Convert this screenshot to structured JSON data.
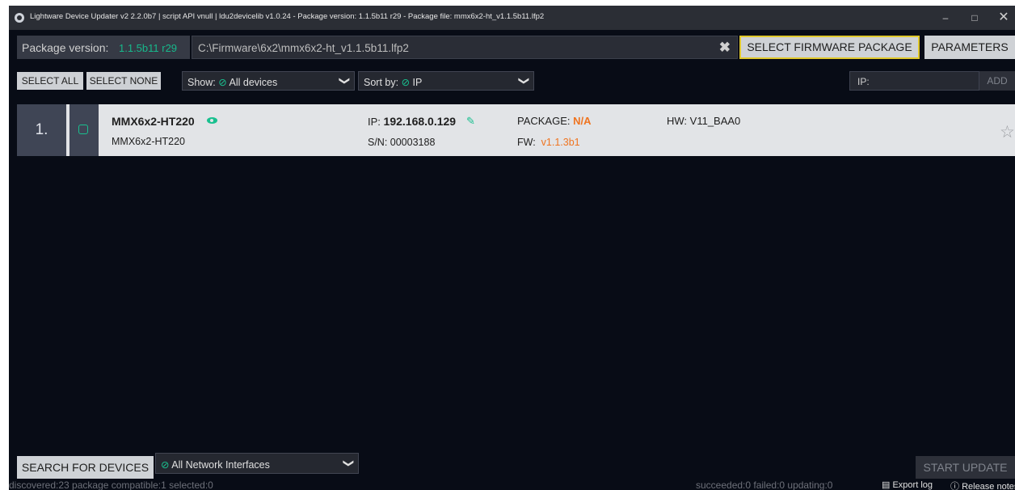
{
  "window": {
    "title": "Lightware Device Updater v2 2.2.0b7 | script API vnull | ldu2devicelib v1.0.24 - Package version: 1.1.5b11 r29 - Package file: mmx6x2-ht_v1.1.5b11.lfp2",
    "controls": {
      "minimize": "–",
      "maximize": "□",
      "close": "✕"
    }
  },
  "package": {
    "version_label": "Package version:",
    "version_value": "1.1.5b11 r29",
    "file_path": "C:\\Firmware\\6x2\\mmx6x2-ht_v1.1.5b11.lfp2",
    "clear_glyph": "✖",
    "select_button": "SELECT FIRMWARE PACKAGE",
    "parameters_button": "PARAMETERS"
  },
  "filters": {
    "select_all": "SELECT ALL",
    "select_none": "SELECT NONE",
    "show_label": "Show:",
    "show_value": "All devices",
    "sort_label": "Sort by:",
    "sort_value": "IP",
    "ip_placeholder": "IP:",
    "add_button": "ADD"
  },
  "devices": [
    {
      "index": "1.",
      "name": "MMX6x2-HT220",
      "model": "MMX6x2-HT220",
      "ip_label": "IP:",
      "ip": "192.168.0.129",
      "serial": "S/N: 00003188",
      "package_label": "PACKAGE:",
      "package": "N/A",
      "fw_label": "FW:",
      "fw": "v1.1.3b1",
      "hw": "HW: V11_BAA0"
    }
  ],
  "bottom": {
    "search_button": "SEARCH FOR DEVICES",
    "interfaces_value": "All Network Interfaces",
    "start_button": "START UPDATE"
  },
  "status": {
    "left": "discovered:23   package compatible:1   selected:0",
    "right": "succeeded:0   failed:0   updating:0",
    "export_log": "Export log",
    "release_notes": "Release notes"
  },
  "colors": {
    "accent_green": "#19c08f",
    "warning_orange": "#ef7420",
    "highlight_yellow": "#e0c82c"
  },
  "icons": [
    "app-logo-icon",
    "clear-icon",
    "check-circle-icon",
    "chevron-down-icon",
    "eye-icon",
    "edit-icon",
    "star-icon",
    "file-icon",
    "info-icon"
  ]
}
